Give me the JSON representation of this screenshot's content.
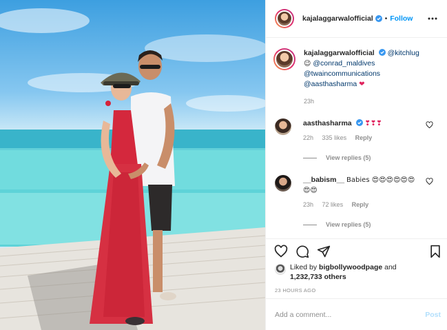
{
  "header": {
    "username": "kajalaggarwalofficial",
    "separator": "•",
    "follow_label": "Follow"
  },
  "caption": {
    "username": "kajalaggarwalofficial",
    "mention_1": "@kitchlug",
    "emoji_1": "😉",
    "mention_2": "@conrad_maldives",
    "mention_3": "@twaincommunications",
    "mention_4": "@aasthasharma",
    "emoji_2": "❤",
    "time": "23h"
  },
  "comments": [
    {
      "username": "aasthasharma",
      "text": "❣❣❣",
      "time": "22h",
      "likes": "335 likes",
      "reply_label": "Reply",
      "view_replies": "View replies (5)"
    },
    {
      "username": "__babism__",
      "text": "Babies 😍😍😍😍😍😍😍😍",
      "time": "23h",
      "likes": "72 likes",
      "reply_label": "Reply",
      "view_replies": "View replies (5)"
    }
  ],
  "likes": {
    "prefix": "Liked by",
    "liker": "bigbollywoodpage",
    "connector": "and",
    "count": "1,232,733 others"
  },
  "timestamp": "23 HOURS AGO",
  "add_comment": {
    "placeholder": "Add a comment...",
    "post_label": "Post"
  },
  "icons": {
    "verified": "verified-badge-icon",
    "more": "more-options-icon",
    "like": "heart-icon",
    "comment": "comment-bubble-icon",
    "share": "paper-plane-icon",
    "save": "bookmark-icon"
  },
  "colors": {
    "accent": "#0095f6",
    "link": "#00376b",
    "muted": "#8e8e8e",
    "heart": "#ed4956"
  }
}
